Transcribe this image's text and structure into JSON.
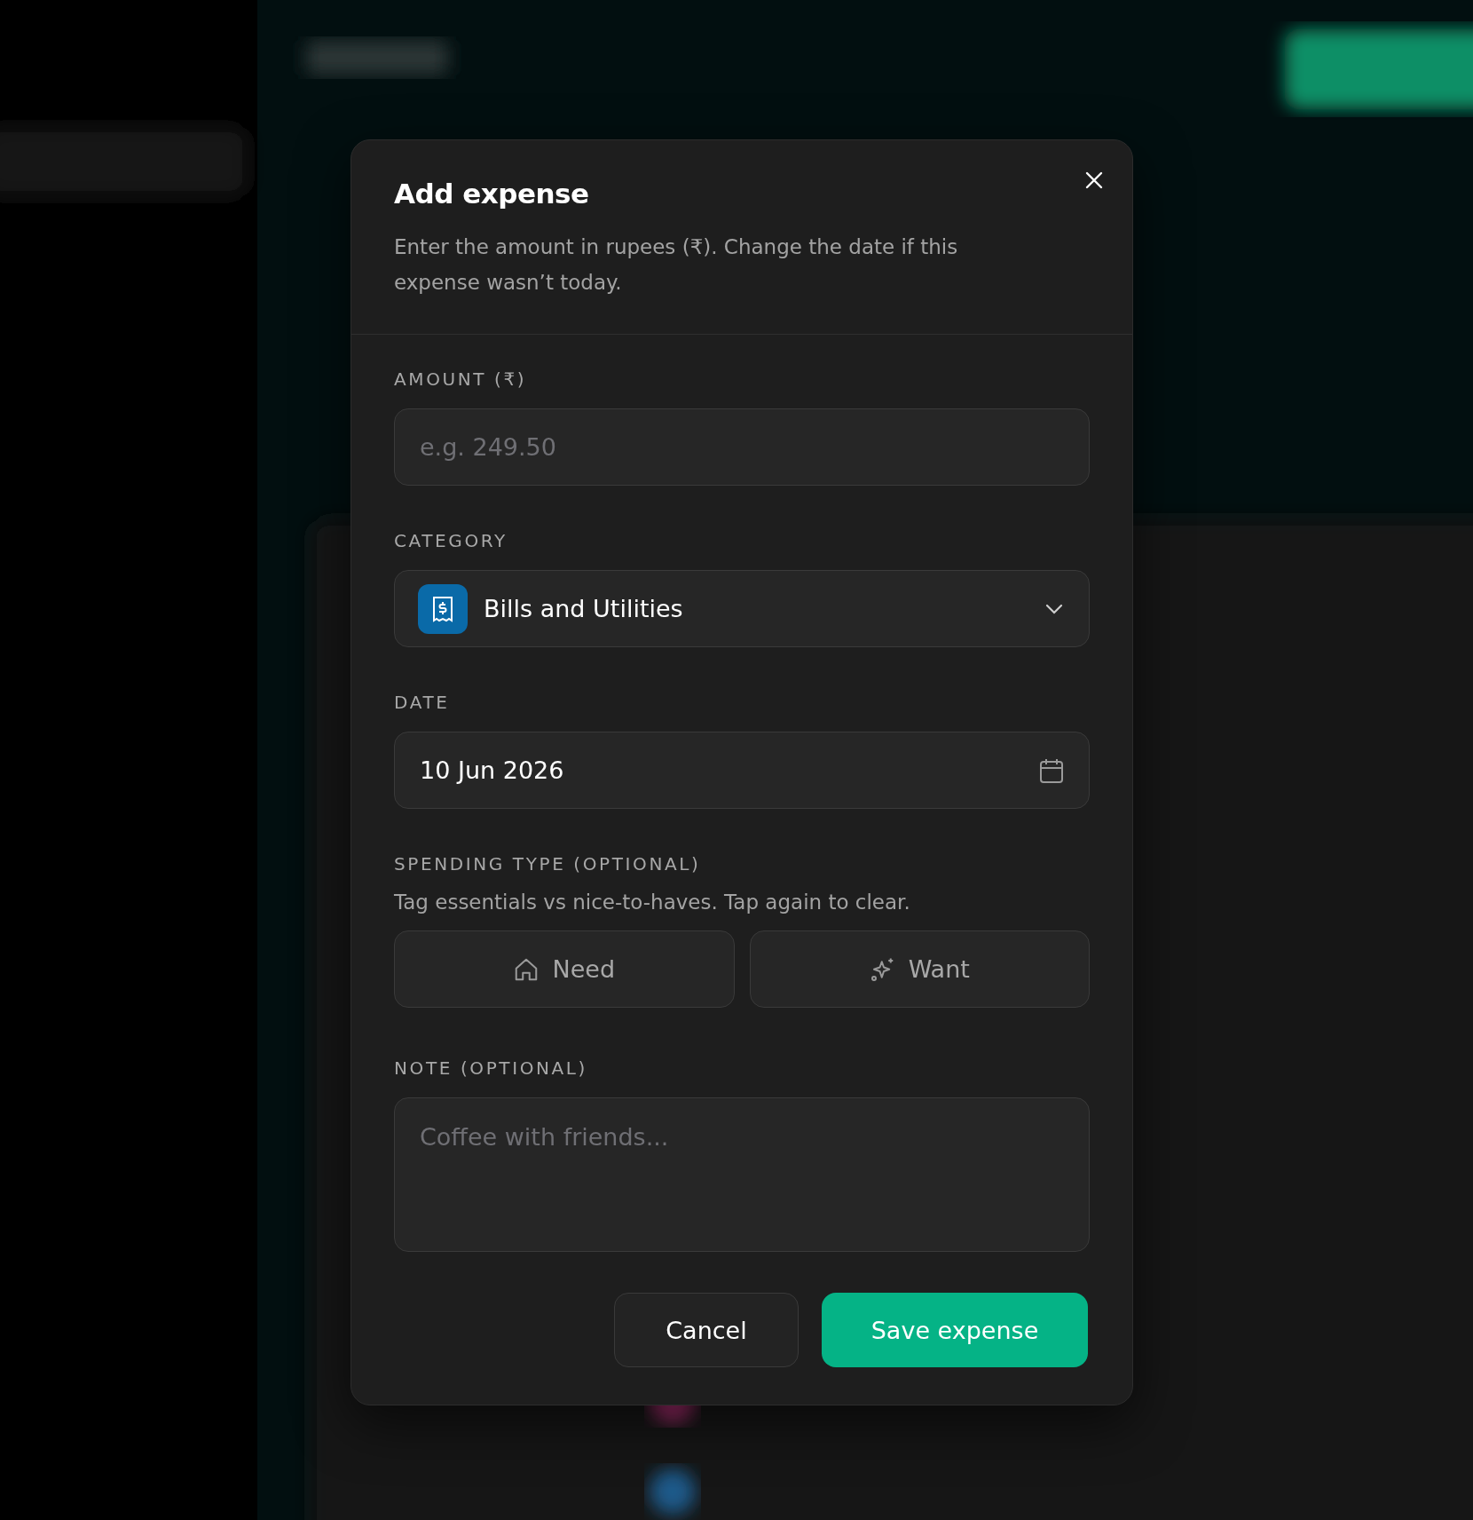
{
  "dialog": {
    "title": "Add expense",
    "description": "Enter the amount in rupees (₹). Change the date if this expense wasn’t today.",
    "amount": {
      "label": "AMOUNT (₹)",
      "placeholder": "e.g. 249.50"
    },
    "category": {
      "label": "CATEGORY",
      "value": "Bills and Utilities",
      "color": "#0a6aa8"
    },
    "date": {
      "label": "DATE",
      "value": "10 Jun 2026"
    },
    "spending_type": {
      "label": "SPENDING TYPE (OPTIONAL)",
      "hint": "Tag essentials vs nice-to-haves. Tap again to clear.",
      "options": [
        {
          "label": "Need",
          "kind": "home",
          "selected": false
        },
        {
          "label": "Want",
          "kind": "sparkle",
          "selected": false
        }
      ]
    },
    "note": {
      "label": "NOTE (OPTIONAL)",
      "placeholder": "Coffee with friends..."
    },
    "buttons": [
      {
        "label": "Cancel",
        "kind": "secondary"
      },
      {
        "label": "Save expense",
        "kind": "primary"
      }
    ]
  }
}
